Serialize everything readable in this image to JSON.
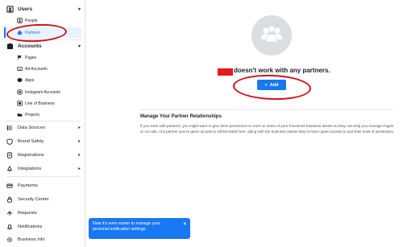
{
  "sidebar": {
    "users": {
      "label": "Users",
      "items": [
        {
          "label": "People",
          "icon": "people-icon"
        },
        {
          "label": "Partners",
          "icon": "partners-icon",
          "active": true
        }
      ]
    },
    "accounts": {
      "label": "Accounts",
      "items": [
        {
          "label": "Pages",
          "icon": "flag-icon"
        },
        {
          "label": "Ad Accounts",
          "icon": "ad-accounts-icon"
        },
        {
          "label": "Apps",
          "icon": "apps-icon"
        },
        {
          "label": "Instagram Accounts",
          "icon": "instagram-icon"
        },
        {
          "label": "Line of Business",
          "icon": "line-of-business-icon"
        },
        {
          "label": "Projects",
          "icon": "projects-icon"
        }
      ]
    },
    "nav": [
      {
        "label": "Data Sources",
        "icon": "data-sources-icon",
        "has_caret": true
      },
      {
        "label": "Brand Safety",
        "icon": "brand-safety-icon",
        "has_caret": true
      },
      {
        "label": "Registrations",
        "icon": "registrations-icon",
        "has_caret": true
      },
      {
        "label": "Integrations",
        "icon": "integrations-icon",
        "has_caret": true
      }
    ],
    "nav2": [
      {
        "label": "Payments",
        "icon": "payments-icon"
      },
      {
        "label": "Security Center",
        "icon": "security-icon"
      },
      {
        "label": "Requests",
        "icon": "requests-icon"
      },
      {
        "label": "Notifications",
        "icon": "notifications-icon"
      },
      {
        "label": "Business Info",
        "icon": "business-info-icon"
      }
    ]
  },
  "main": {
    "headline": "doesn't work with any partners.",
    "add_label": "Add",
    "section_title": "Manage Your Partner Relationships",
    "section_text": "If you work with partners, you might want to give them permission to work on some of your Facebook business assets so they can help you manage Pages or run ads. Any partner you've given access to will be listed here, along with the business assets they've been given access to and their level of permission."
  },
  "toast": {
    "text": "Now it's even easier to manage your personal notification settings.",
    "close": "×"
  },
  "colors": {
    "accent": "#1877f2",
    "annotation": "#d0111a",
    "redaction": "#e8191a"
  }
}
